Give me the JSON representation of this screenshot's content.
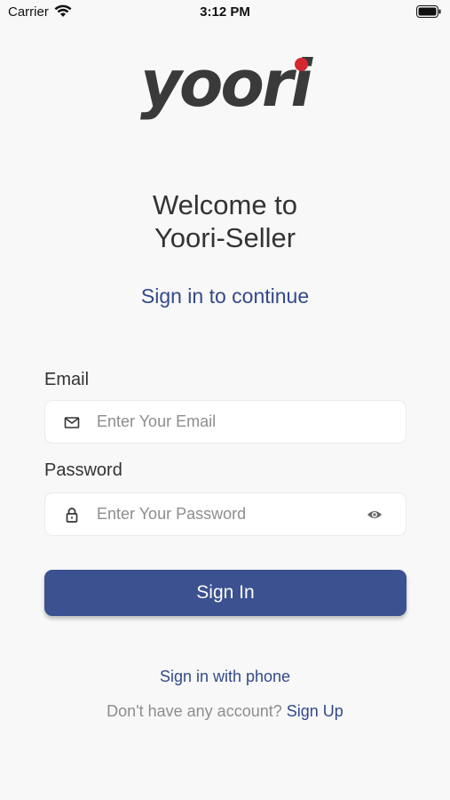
{
  "status_bar": {
    "carrier": "Carrier",
    "time": "3:12 PM",
    "icons": [
      "wifi-icon",
      "battery-icon"
    ]
  },
  "logo": {
    "text": "yoori",
    "dot_color": "#d52731",
    "text_color": "#3a3a3a"
  },
  "welcome": {
    "line1": "Welcome to",
    "line2": "Yoori-Seller"
  },
  "subtitle": "Sign in to continue",
  "form": {
    "email": {
      "label": "Email",
      "placeholder": "Enter Your Email",
      "value": "",
      "icon": "mail-icon"
    },
    "password": {
      "label": "Password",
      "placeholder": "Enter Your Password",
      "value": "",
      "icon": "lock-icon",
      "toggle_icon": "eye-icon"
    },
    "submit_label": "Sign In"
  },
  "alt_login": "Sign in with phone",
  "signup": {
    "prompt": "Don't have any account?",
    "link": "Sign Up"
  },
  "colors": {
    "accent": "#3b5190",
    "link": "#33498a",
    "background": "#f8f8f8"
  }
}
